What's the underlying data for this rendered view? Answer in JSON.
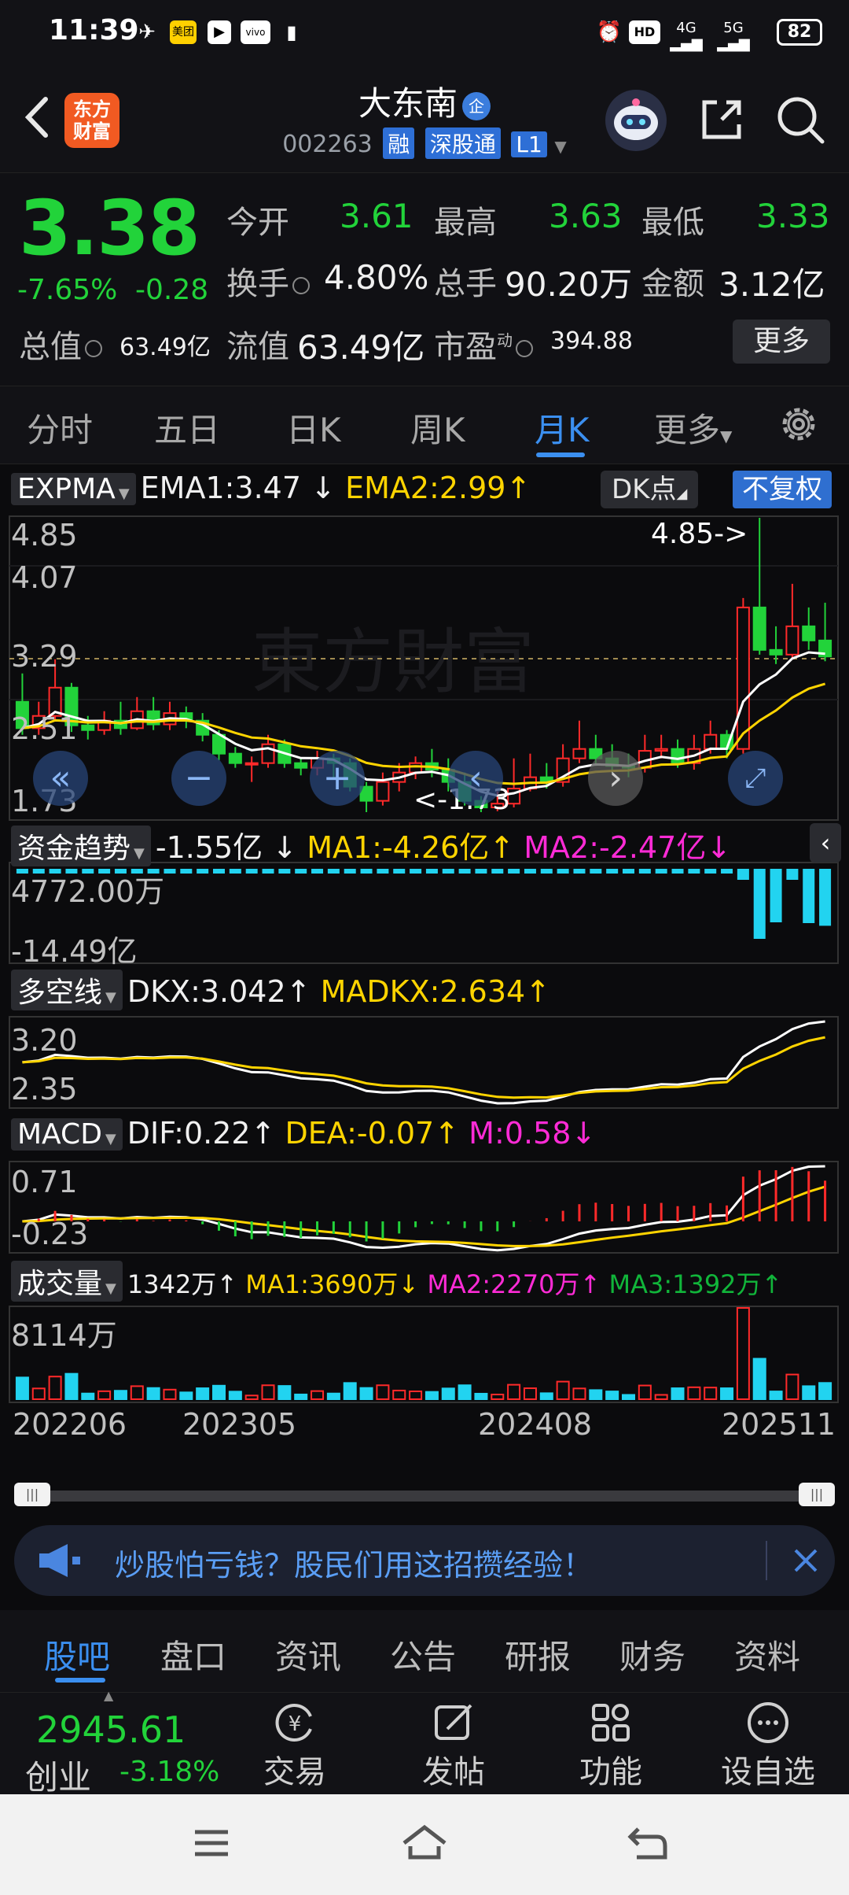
{
  "status_bar": {
    "time": "11:39",
    "battery": "82",
    "net1": "HD",
    "net2": "4G",
    "net3": "5G",
    "meituan": "美团",
    "vivo": "vivo"
  },
  "header": {
    "logo_line1": "东方",
    "logo_line2": "财富",
    "title": "大东南",
    "title_badge": "企",
    "code": "002263",
    "tag_margin": "融",
    "tag_connect": "深股通",
    "tag_level": "L1"
  },
  "quote": {
    "price": "3.38",
    "change_pct": "-7.65%",
    "change": "-0.28",
    "open_label": "今开",
    "open": "3.61",
    "high_label": "最高",
    "high": "3.63",
    "low_label": "最低",
    "low": "3.33",
    "turnover_label": "换手",
    "turnover": "4.80%",
    "volume_label": "总手",
    "volume": "90.20万",
    "amount_label": "金额",
    "amount": "3.12亿",
    "mktcap_label": "总值",
    "mktcap": "63.49亿",
    "float_label": "流值",
    "float_cap": "63.49亿",
    "pe_label": "市盈",
    "pe_sup": "动",
    "pe": "394.88",
    "more": "更多"
  },
  "period_tabs": [
    "分时",
    "五日",
    "日K",
    "周K",
    "月K",
    "更多"
  ],
  "active_tab": "月K",
  "kline": {
    "indicator": "EXPMA",
    "ema1": "EMA1:3.47",
    "ema1_arrow": "↓",
    "ema2": "EMA2:2.99",
    "ema2_arrow": "↑",
    "dk_button": "DK点",
    "fuquan_button": "不复权",
    "y_labels": [
      "4.85",
      "4.07",
      "3.29",
      "2.51",
      "1.73"
    ],
    "high_annotation": "4.85->",
    "low_annotation": "<-1.73"
  },
  "fund_flow": {
    "label": "资金趋势",
    "value": "-1.55亿",
    "value_arrow": "↓",
    "ma1": "MA1:-4.26亿",
    "ma1_arrow": "↑",
    "ma2": "MA2:-2.47亿",
    "ma2_arrow": "↓",
    "y_top": "4772.00万",
    "y_bottom": "-14.49亿"
  },
  "dkx": {
    "label": "多空线",
    "dkx": "DKX:3.042",
    "dkx_arrow": "↑",
    "madkx": "MADKX:2.634",
    "madkx_arrow": "↑",
    "y_top": "3.20",
    "y_bottom": "2.35"
  },
  "macd": {
    "label": "MACD",
    "dif": "DIF:0.22",
    "dif_arrow": "↑",
    "dea": "DEA:-0.07",
    "dea_arrow": "↑",
    "m": "M:0.58",
    "m_arrow": "↓",
    "y_top": "0.71",
    "y_bottom": "-0.23"
  },
  "volume": {
    "label": "成交量",
    "vol": "1342万",
    "vol_arrow": "↑",
    "ma1": "MA1:3690万",
    "ma1_arrow": "↓",
    "ma2": "MA2:2270万",
    "ma2_arrow": "↑",
    "ma3": "MA3:1392万",
    "ma3_arrow": "↑",
    "y_top": "8114万"
  },
  "x_labels": [
    "202206",
    "202305",
    "202408",
    "202511"
  ],
  "banner": {
    "text": "炒股怕亏钱？股民们用这招攒经验！"
  },
  "sub_tabs": [
    "股吧",
    "盘口",
    "资讯",
    "公告",
    "研报",
    "财务",
    "资料"
  ],
  "active_sub_tab": "股吧",
  "bottom_bar": {
    "index_value": "2945.61",
    "index_name": "创业",
    "index_change": "-3.18%",
    "trade": "交易",
    "post": "发帖",
    "functions": "功能",
    "watchlist": "设自选"
  },
  "colors": {
    "up": "#ff2a2a",
    "down": "#22d33a",
    "accent": "#3b8ff0",
    "ema1": "#ffffff",
    "ema2": "#ffd400"
  },
  "chart_data": {
    "type": "candlestick",
    "period": "monthly",
    "x_ticks": [
      "202206",
      "202305",
      "202408",
      "202511"
    ],
    "ylim": [
      1.73,
      4.85
    ],
    "candles": [
      [
        2.9,
        2.62,
        3.2,
        2.55
      ],
      [
        2.62,
        2.75,
        2.9,
        2.55
      ],
      [
        2.75,
        3.05,
        3.35,
        2.7
      ],
      [
        3.05,
        2.65,
        3.1,
        2.58
      ],
      [
        2.65,
        2.6,
        2.75,
        2.5
      ],
      [
        2.6,
        2.7,
        2.8,
        2.55
      ],
      [
        2.7,
        2.62,
        2.9,
        2.55
      ],
      [
        2.62,
        2.8,
        2.95,
        2.6
      ],
      [
        2.8,
        2.66,
        2.95,
        2.6
      ],
      [
        2.66,
        2.78,
        2.9,
        2.6
      ],
      [
        2.78,
        2.7,
        2.85,
        2.62
      ],
      [
        2.7,
        2.55,
        2.78,
        2.48
      ],
      [
        2.55,
        2.35,
        2.6,
        2.28
      ],
      [
        2.35,
        2.25,
        2.42,
        2.2
      ],
      [
        2.25,
        2.25,
        2.32,
        2.05
      ],
      [
        2.25,
        2.45,
        2.55,
        2.2
      ],
      [
        2.45,
        2.25,
        2.5,
        2.2
      ],
      [
        2.25,
        2.2,
        2.3,
        2.12
      ],
      [
        2.2,
        2.3,
        2.38,
        2.12
      ],
      [
        2.3,
        2.25,
        2.35,
        2.1
      ],
      [
        2.25,
        2.0,
        2.3,
        1.95
      ],
      [
        2.0,
        1.85,
        2.05,
        1.73
      ],
      [
        1.85,
        2.05,
        2.15,
        1.8
      ],
      [
        2.05,
        2.15,
        2.25,
        1.95
      ],
      [
        2.15,
        2.25,
        2.32,
        2.08
      ],
      [
        2.25,
        2.18,
        2.4,
        2.1
      ],
      [
        2.18,
        2.05,
        2.3,
        1.95
      ],
      [
        2.05,
        1.85,
        2.15,
        1.8
      ],
      [
        1.85,
        1.78,
        1.9,
        1.73
      ],
      [
        1.78,
        1.82,
        1.95,
        1.74
      ],
      [
        1.82,
        1.98,
        2.3,
        1.78
      ],
      [
        1.98,
        2.1,
        2.35,
        1.95
      ],
      [
        2.1,
        2.05,
        2.25,
        1.98
      ],
      [
        2.05,
        2.3,
        2.45,
        2.0
      ],
      [
        2.3,
        2.4,
        2.7,
        2.25
      ],
      [
        2.4,
        2.3,
        2.55,
        2.22
      ],
      [
        2.3,
        2.22,
        2.45,
        2.15
      ],
      [
        2.22,
        2.2,
        2.35,
        2.1
      ],
      [
        2.2,
        2.38,
        2.55,
        2.15
      ],
      [
        2.38,
        2.4,
        2.55,
        2.3
      ],
      [
        2.4,
        2.25,
        2.5,
        2.2
      ],
      [
        2.25,
        2.4,
        2.55,
        2.18
      ],
      [
        2.4,
        2.55,
        2.7,
        2.35
      ],
      [
        2.55,
        2.4,
        2.6,
        2.3
      ],
      [
        2.4,
        3.9,
        4.0,
        2.35
      ],
      [
        3.9,
        3.45,
        4.85,
        3.4
      ],
      [
        3.45,
        3.4,
        3.7,
        3.3
      ],
      [
        3.4,
        3.7,
        4.15,
        3.35
      ],
      [
        3.7,
        3.55,
        3.9,
        3.45
      ],
      [
        3.55,
        3.38,
        3.95,
        3.33
      ]
    ],
    "ema1_last": 3.47,
    "ema2_last": 2.99
  }
}
